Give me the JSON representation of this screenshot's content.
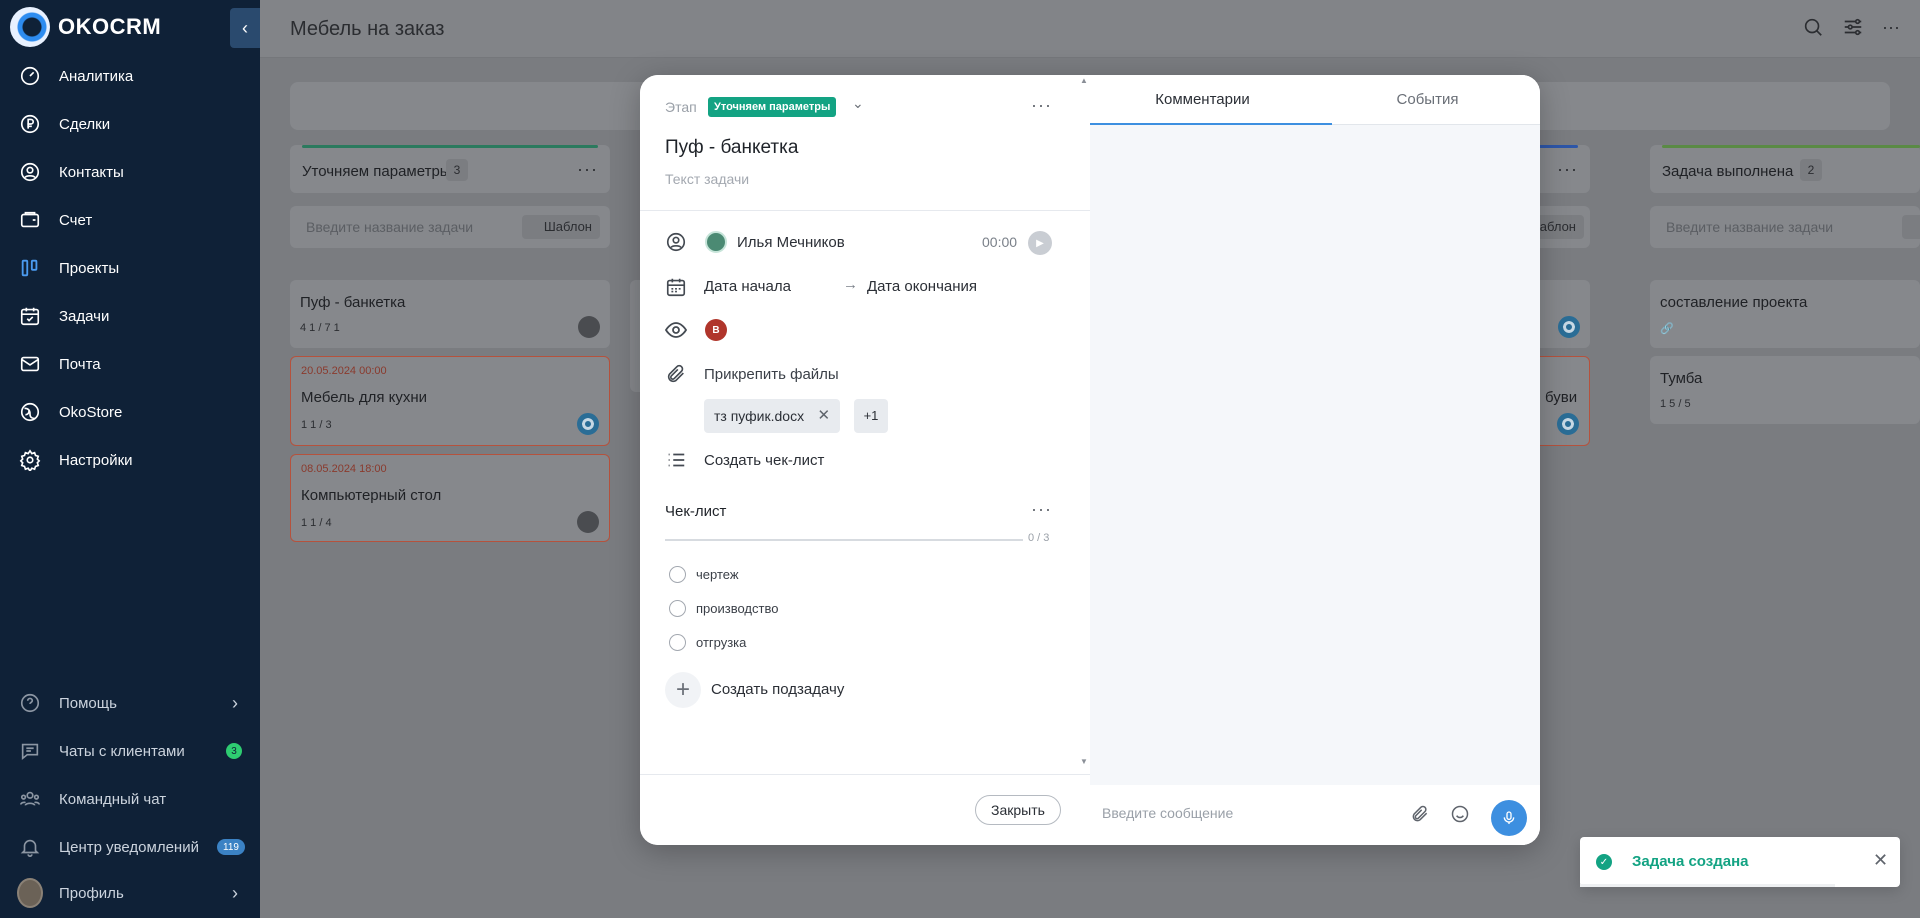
{
  "app": {
    "logo_text": "OKOCRM"
  },
  "sidebar": {
    "items": [
      {
        "label": "Аналитика",
        "icon": "gauge-icon"
      },
      {
        "label": "Сделки",
        "icon": "ruble-icon"
      },
      {
        "label": "Контакты",
        "icon": "user-circle-icon"
      },
      {
        "label": "Счет",
        "icon": "invoice-icon"
      },
      {
        "label": "Проекты",
        "icon": "kanban-icon"
      },
      {
        "label": "Задачи",
        "icon": "calendar-check-icon"
      },
      {
        "label": "Почта",
        "icon": "mail-icon"
      },
      {
        "label": "OkoStore",
        "icon": "store-icon"
      },
      {
        "label": "Настройки",
        "icon": "gear-icon"
      }
    ],
    "bottom": {
      "help": "Помощь",
      "client_chats": "Чаты с клиентами",
      "client_chats_badge": "3",
      "team_chat": "Командный чат",
      "notifications": "Центр уведомлений",
      "notifications_badge": "119",
      "profile": "Профиль"
    }
  },
  "board": {
    "title": "Мебель на заказ",
    "columns": [
      {
        "title": "Уточняем параметры",
        "count": "3",
        "color": "#2b7a5e"
      },
      {
        "title": "Задача выполнена",
        "count": "2",
        "color": "#5a8a45"
      }
    ],
    "add_task_placeholder": "Введите название задачи",
    "template_label": "Шаблон",
    "tasks_col1": [
      {
        "name": "Пуф - банкетка",
        "meta": "4  1 / 7  1"
      },
      {
        "date": "20.05.2024 00:00",
        "name": "Мебель для кухни",
        "meta": "1  1 / 3"
      },
      {
        "date": "08.05.2024 18:00",
        "name": "Компьютерный стол",
        "meta": "1  1 / 4"
      }
    ],
    "tasks_col4": [
      {
        "name": "составление проекта"
      },
      {
        "name": "Тумба",
        "meta": "1  5 / 5"
      }
    ],
    "partial_task_text": "буви"
  },
  "modal": {
    "stage_label": "Этап",
    "stage_value": "Уточняем параметры",
    "task_title": "Пуф - банкетка",
    "task_description_placeholder": "Текст задачи",
    "assignee": "Илья Мечников",
    "timer": "00:00",
    "date_start": "Дата начала",
    "date_arrow": "→",
    "date_end": "Дата окончания",
    "watcher_initial": "В",
    "attach_label": "Прикрепить файлы",
    "file_name": "тз пуфик.docx",
    "file_more": "+1",
    "create_checklist": "Создать чек-лист",
    "checklist_title": "Чек-лист",
    "checklist_progress_text": "0 / 3",
    "checklist_progress": 0,
    "checklist_items": [
      "чертеж",
      "производство",
      "отгрузка"
    ],
    "create_subtask": "Создать подзадачу",
    "close_label": "Закрыть",
    "tabs": [
      "Комментарии",
      "События"
    ],
    "message_placeholder": "Введите сообщение"
  },
  "toast": {
    "text": "Задача создана"
  }
}
